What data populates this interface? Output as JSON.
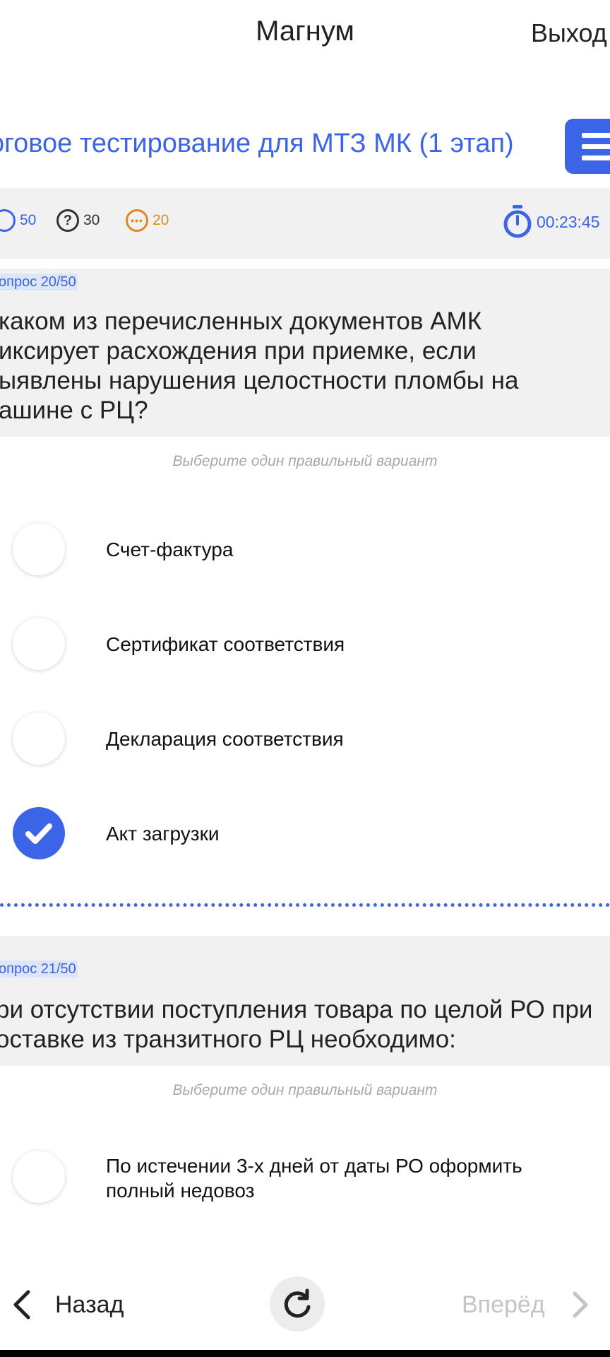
{
  "header": {
    "app_title": "Магнум",
    "logout_label": "Выход"
  },
  "test": {
    "title": "тоговое тестирование для МТЗ МК (1 этап)"
  },
  "stats": {
    "total": "50",
    "unanswered": "30",
    "answered": "20",
    "timer": "00:23:45",
    "icons": [
      "list-icon",
      "question-mark-icon",
      "dots-icon",
      "stopwatch-icon"
    ],
    "colors": {
      "accent": "#3b64e6",
      "answered": "#e08a1e",
      "neutral": "#333333"
    }
  },
  "questions": [
    {
      "number_label": "опрос 20/50",
      "text_lines": [
        " каком из перечисленных документов АМК",
        "иксирует расхождения при приемке, если",
        "ыявлены нарушения целостности пломбы на",
        "ашине с РЦ?"
      ],
      "hint": "Выберите один правильный вариант",
      "options": [
        {
          "label": "Счет-фактура",
          "checked": false
        },
        {
          "label": "Сертификат соответствия",
          "checked": false
        },
        {
          "label": "Декларация соответствия",
          "checked": false
        },
        {
          "label": "Акт загрузки",
          "checked": true
        }
      ]
    },
    {
      "number_label": "опрос 21/50",
      "text_lines": [
        "ри отсутствии поступления товара по целой РО при",
        "оставке из транзитного РЦ необходимо:"
      ],
      "hint": "Выберите один правильный вариант",
      "options": [
        {
          "label_lines": [
            "По истечении 3-х дней от даты РО оформить",
            "полный недовоз"
          ],
          "checked": false
        }
      ]
    }
  ],
  "nav": {
    "back_label": "Назад",
    "forward_label": "Вперёд"
  }
}
